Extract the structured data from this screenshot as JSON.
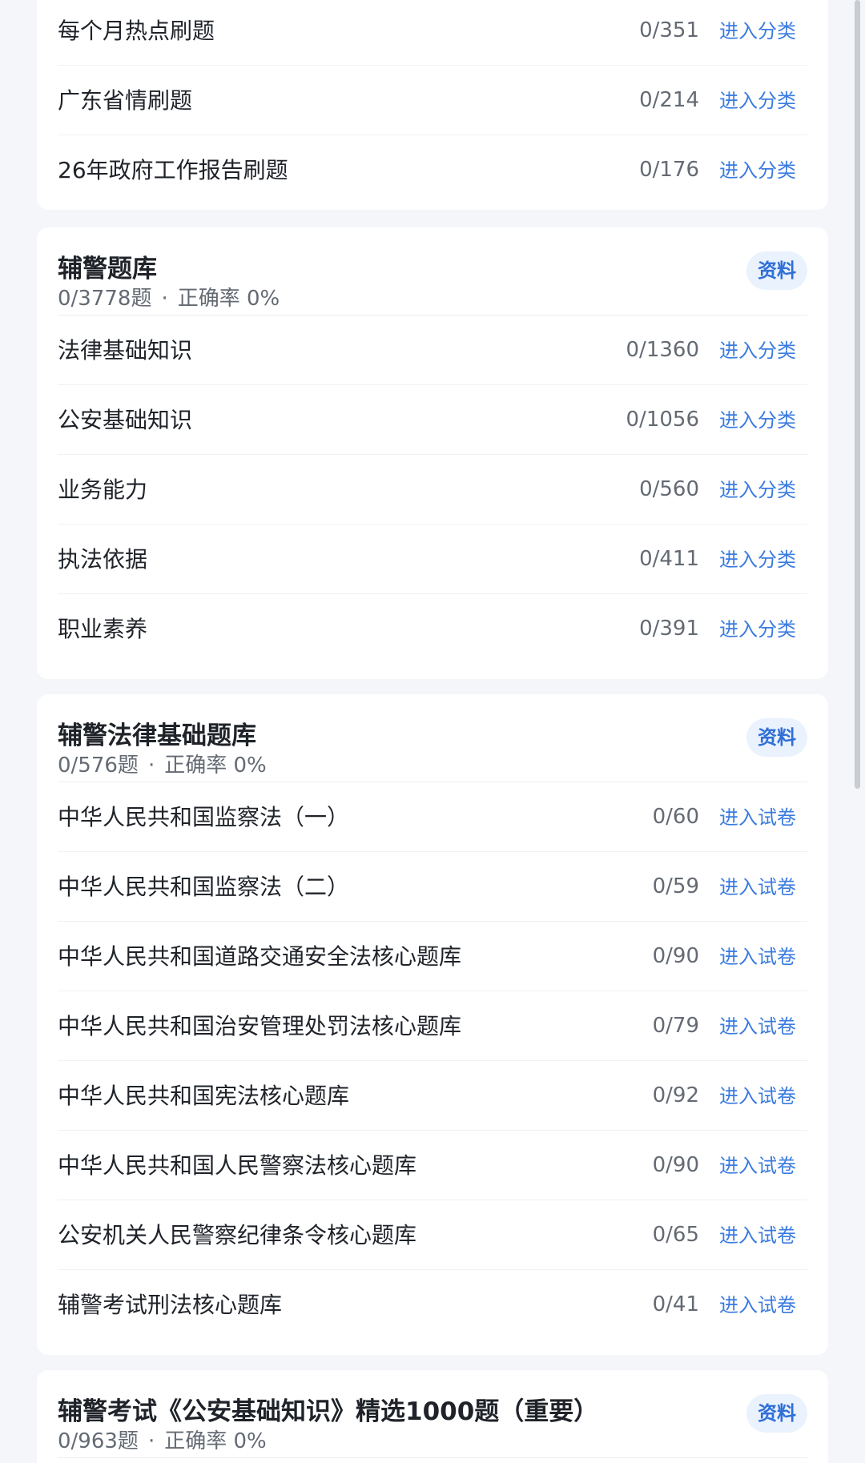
{
  "sections": [
    {
      "items": [
        {
          "name": "每个月热点刷题",
          "count": "0/351",
          "action": "进入分类"
        },
        {
          "name": "广东省情刷题",
          "count": "0/214",
          "action": "进入分类"
        },
        {
          "name": "26年政府工作报告刷题",
          "count": "0/176",
          "action": "进入分类"
        }
      ]
    },
    {
      "title": "辅警题库",
      "progress": "0/3778题",
      "separator": "·",
      "accuracy": "正确率 0%",
      "badge": "资料",
      "items": [
        {
          "name": "法律基础知识",
          "count": "0/1360",
          "action": "进入分类"
        },
        {
          "name": "公安基础知识",
          "count": "0/1056",
          "action": "进入分类"
        },
        {
          "name": "业务能力",
          "count": "0/560",
          "action": "进入分类"
        },
        {
          "name": "执法依据",
          "count": "0/411",
          "action": "进入分类"
        },
        {
          "name": "职业素养",
          "count": "0/391",
          "action": "进入分类"
        }
      ]
    },
    {
      "title": "辅警法律基础题库",
      "progress": "0/576题",
      "separator": "·",
      "accuracy": "正确率 0%",
      "badge": "资料",
      "items": [
        {
          "name": "中华人民共和国监察法（一）",
          "count": "0/60",
          "action": "进入试卷"
        },
        {
          "name": "中华人民共和国监察法（二）",
          "count": "0/59",
          "action": "进入试卷"
        },
        {
          "name": "中华人民共和国道路交通安全法核心题库",
          "count": "0/90",
          "action": "进入试卷"
        },
        {
          "name": "中华人民共和国治安管理处罚法核心题库",
          "count": "0/79",
          "action": "进入试卷"
        },
        {
          "name": "中华人民共和国宪法核心题库",
          "count": "0/92",
          "action": "进入试卷"
        },
        {
          "name": "中华人民共和国人民警察法核心题库",
          "count": "0/90",
          "action": "进入试卷"
        },
        {
          "name": "公安机关人民警察纪律条令核心题库",
          "count": "0/65",
          "action": "进入试卷"
        },
        {
          "name": "辅警考试刑法核心题库",
          "count": "0/41",
          "action": "进入试卷"
        }
      ]
    },
    {
      "title": "辅警考试《公安基础知识》精选1000题（重要）",
      "progress": "0/963题",
      "separator": "·",
      "accuracy": "正确率 0%",
      "badge": "资料"
    }
  ]
}
